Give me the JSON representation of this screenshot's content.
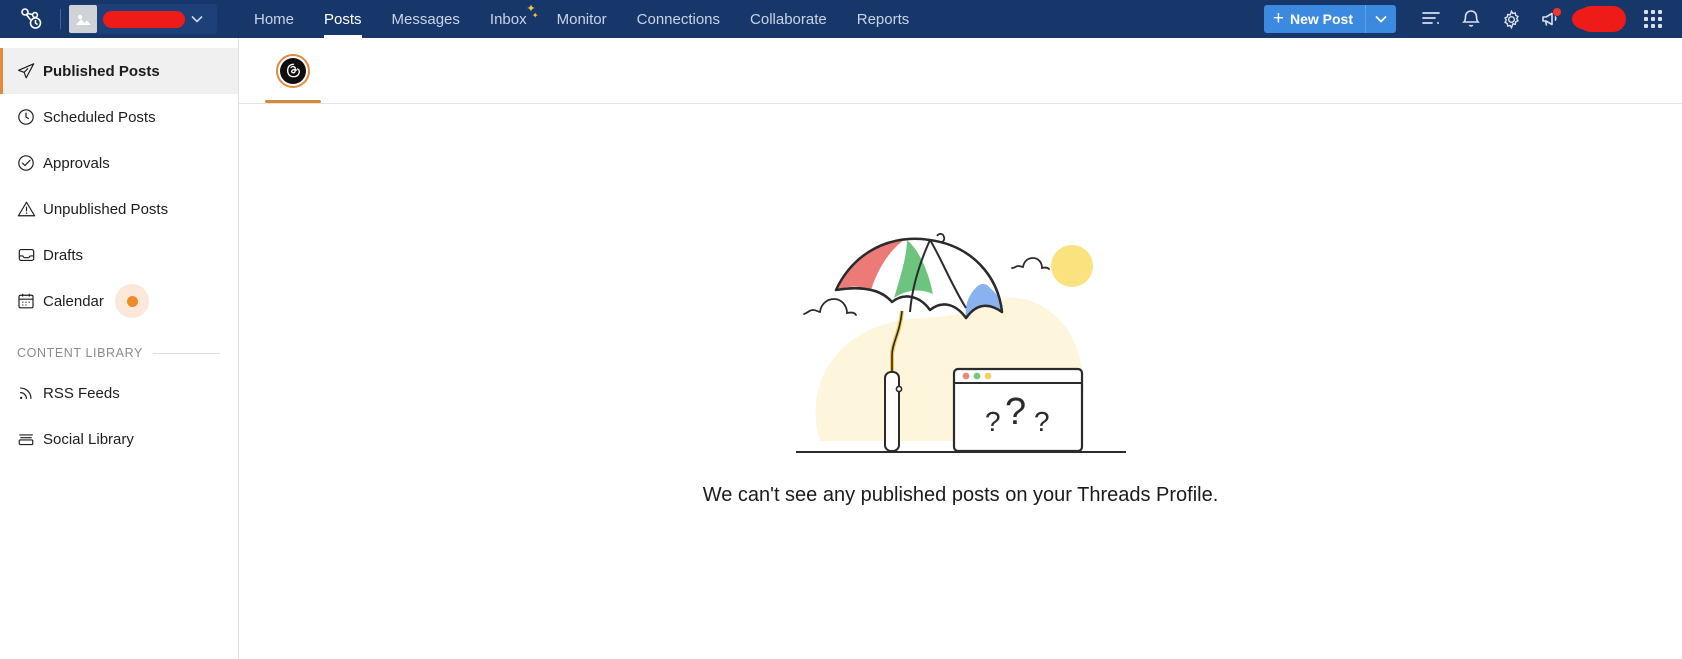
{
  "topbar": {
    "logo_icon": "brand-logo-icon",
    "workspace": {
      "thumb_icon": "image-placeholder-icon",
      "name_redacted": "",
      "chevron_icon": "chevron-down-icon"
    },
    "nav": [
      {
        "label": "Home",
        "active": false,
        "badge": ""
      },
      {
        "label": "Posts",
        "active": true,
        "badge": ""
      },
      {
        "label": "Messages",
        "active": false,
        "badge": ""
      },
      {
        "label": "Inbox",
        "active": false,
        "badge": "sparkle"
      },
      {
        "label": "Monitor",
        "active": false,
        "badge": ""
      },
      {
        "label": "Connections",
        "active": false,
        "badge": ""
      },
      {
        "label": "Collaborate",
        "active": false,
        "badge": ""
      },
      {
        "label": "Reports",
        "active": false,
        "badge": ""
      }
    ],
    "new_post_label": "New Post",
    "new_post_plus": "+",
    "icons": {
      "list": "list-lines-icon",
      "bell": "notification-bell-icon",
      "gear": "settings-gear-icon",
      "megaphone": "announcements-megaphone-icon",
      "avatar": "user-avatar-redacted",
      "apps": "apps-grid-icon"
    }
  },
  "sidebar": {
    "items": [
      {
        "label": "Published Posts",
        "icon": "paper-plane-icon",
        "active": true,
        "dot": false
      },
      {
        "label": "Scheduled Posts",
        "icon": "clock-icon",
        "active": false,
        "dot": false
      },
      {
        "label": "Approvals",
        "icon": "check-circle-icon",
        "active": false,
        "dot": false
      },
      {
        "label": "Unpublished Posts",
        "icon": "warning-triangle-icon",
        "active": false,
        "dot": false
      },
      {
        "label": "Drafts",
        "icon": "inbox-tray-icon",
        "active": false,
        "dot": false
      },
      {
        "label": "Calendar",
        "icon": "calendar-icon",
        "active": false,
        "dot": true
      }
    ],
    "section_label": "CONTENT LIBRARY",
    "library_items": [
      {
        "label": "RSS Feeds",
        "icon": "rss-feed-icon"
      },
      {
        "label": "Social Library",
        "icon": "stacked-layers-icon"
      }
    ]
  },
  "main": {
    "tab": {
      "name": "threads-profile-tab",
      "icon": "threads-logo-icon",
      "active": true
    },
    "empty_state": {
      "illustration": "umbrella-browser-question-marks-illustration",
      "message": "We can't see any published posts on your Threads Profile."
    }
  },
  "colors": {
    "topbar_bg": "#17376b",
    "accent_blue": "#3c8ae0",
    "accent_orange": "#e8883a",
    "redaction_red": "#ee1b18",
    "illustration_cream": "#fdf5dc"
  }
}
